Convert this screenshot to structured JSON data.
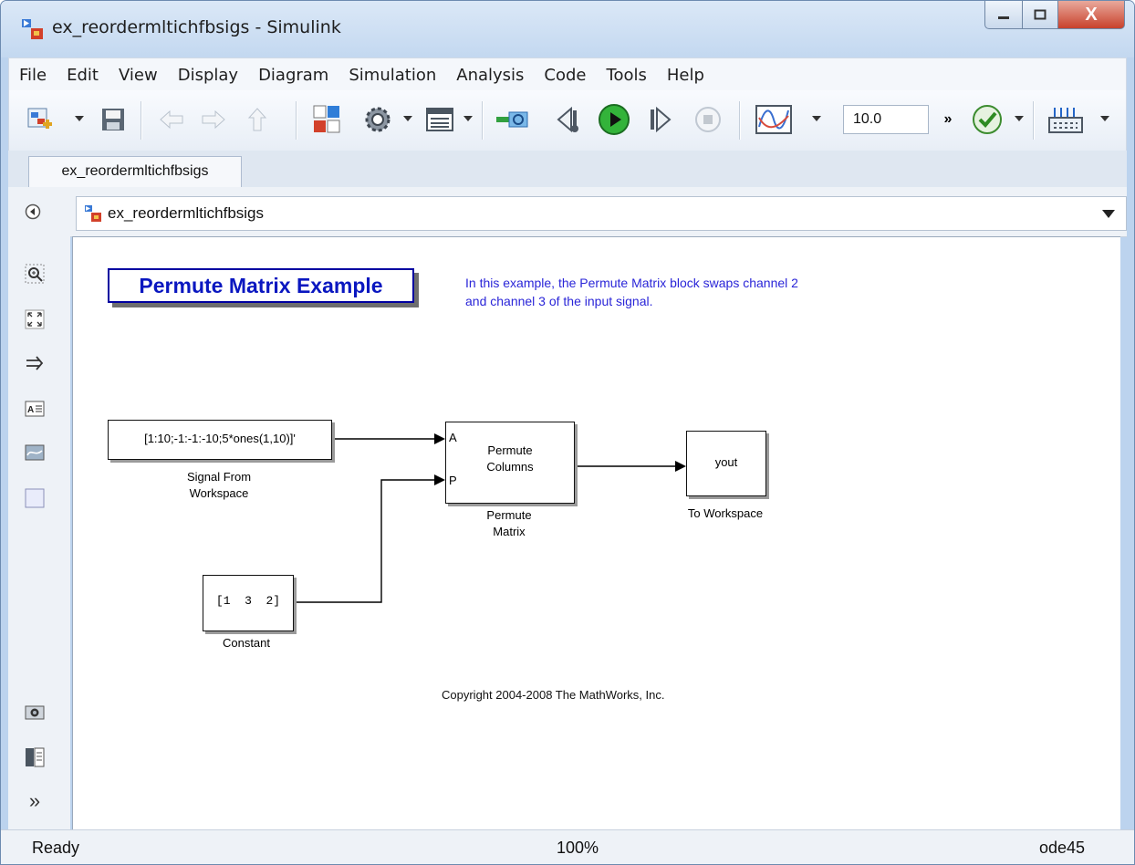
{
  "window": {
    "title": "ex_reordermltichfbsigs - Simulink",
    "close_label": "X"
  },
  "menu": [
    "File",
    "Edit",
    "View",
    "Display",
    "Diagram",
    "Simulation",
    "Analysis",
    "Code",
    "Tools",
    "Help"
  ],
  "toolbar": {
    "stop_time": "10.0",
    "overflow_label": "»",
    "icons": [
      "new-model-icon",
      "save-icon",
      "back-arrow-icon",
      "forward-arrow-icon",
      "up-arrow-icon",
      "library-browser-icon",
      "model-config-icon",
      "model-explorer-icon",
      "update-diagram-icon",
      "step-back-icon",
      "run-icon",
      "step-forward-icon",
      "stop-icon",
      "scope-icon",
      "model-advisor-icon",
      "build-icon"
    ]
  },
  "tab": {
    "label": "ex_reordermltichfbsigs"
  },
  "explorer": {
    "path": "ex_reordermltichfbsigs"
  },
  "palette": {
    "icons": [
      "zoom-icon",
      "fit-to-view-icon",
      "arrow-icon",
      "annotation-icon",
      "image-icon",
      "area-icon",
      "screenshot-icon",
      "model-browser-icon",
      "expand-icon"
    ],
    "expand_label": "»"
  },
  "diagram": {
    "title": "Permute Matrix Example",
    "description": "In this example, the Permute Matrix block swaps channel 2 and channel 3 of the input signal.",
    "signal_block": {
      "expression": "[1:10;-1:-1:-10;5*ones(1,10)]'",
      "label_line1": "Signal From",
      "label_line2": "Workspace"
    },
    "permute_block": {
      "port_a": "A",
      "port_p": "P",
      "text_line1": "Permute",
      "text_line2": "Columns",
      "label_line1": "Permute",
      "label_line2": "Matrix"
    },
    "yout_block": {
      "text": "yout",
      "label": "To Workspace"
    },
    "constant_block": {
      "value": "[1  3  2]",
      "label": "Constant"
    },
    "copyright": "Copyright 2004-2008 The MathWorks, Inc."
  },
  "status": {
    "state": "Ready",
    "zoom": "100%",
    "solver": "ode45"
  }
}
